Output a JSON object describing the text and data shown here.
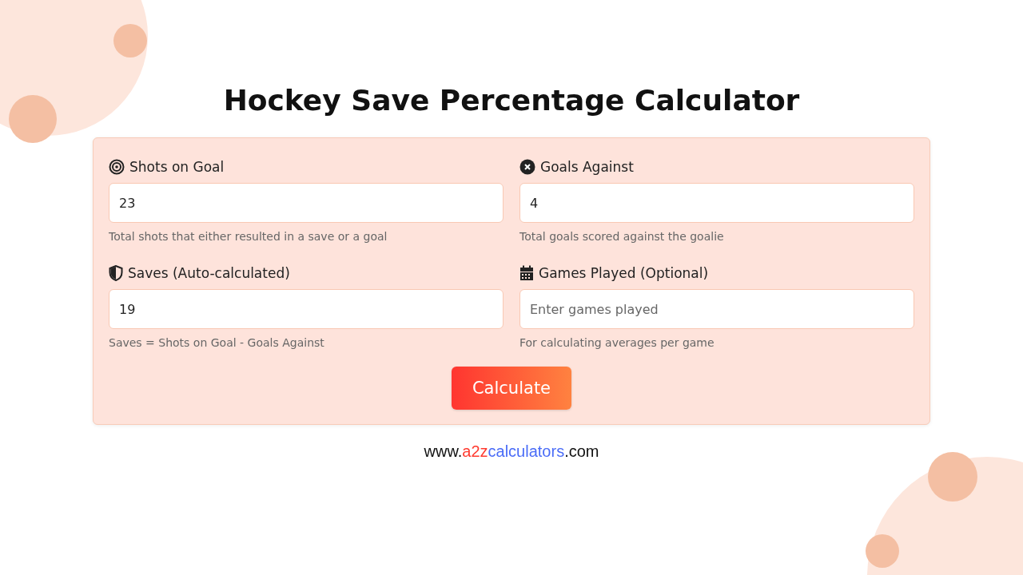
{
  "title": "Hockey Save Percentage Calculator",
  "fields": [
    {
      "kind": "target",
      "label": "Shots on Goal",
      "value": "23",
      "help": "Total shots that either resulted in a save or a goal"
    },
    {
      "kind": "x-circle",
      "label": "Goals Against",
      "value": "4",
      "help": "Total goals scored against the goalie"
    },
    {
      "kind": "shield",
      "label": "Saves (Auto-calculated)",
      "value": "19",
      "help": "Saves = Shots on Goal - Goals Against"
    },
    {
      "kind": "calendar",
      "label": "Games Played (Optional)",
      "placeholder": "Enter games played",
      "help": "For calculating averages per game"
    }
  ],
  "button": "Calculate",
  "footer": [
    {
      "text": "www.",
      "color": "#111111"
    },
    {
      "text": "a2z",
      "color": "#ff3b30"
    },
    {
      "text": "calculators",
      "color": "#4a6cf7"
    },
    {
      "text": ".com",
      "color": "#111111"
    }
  ]
}
